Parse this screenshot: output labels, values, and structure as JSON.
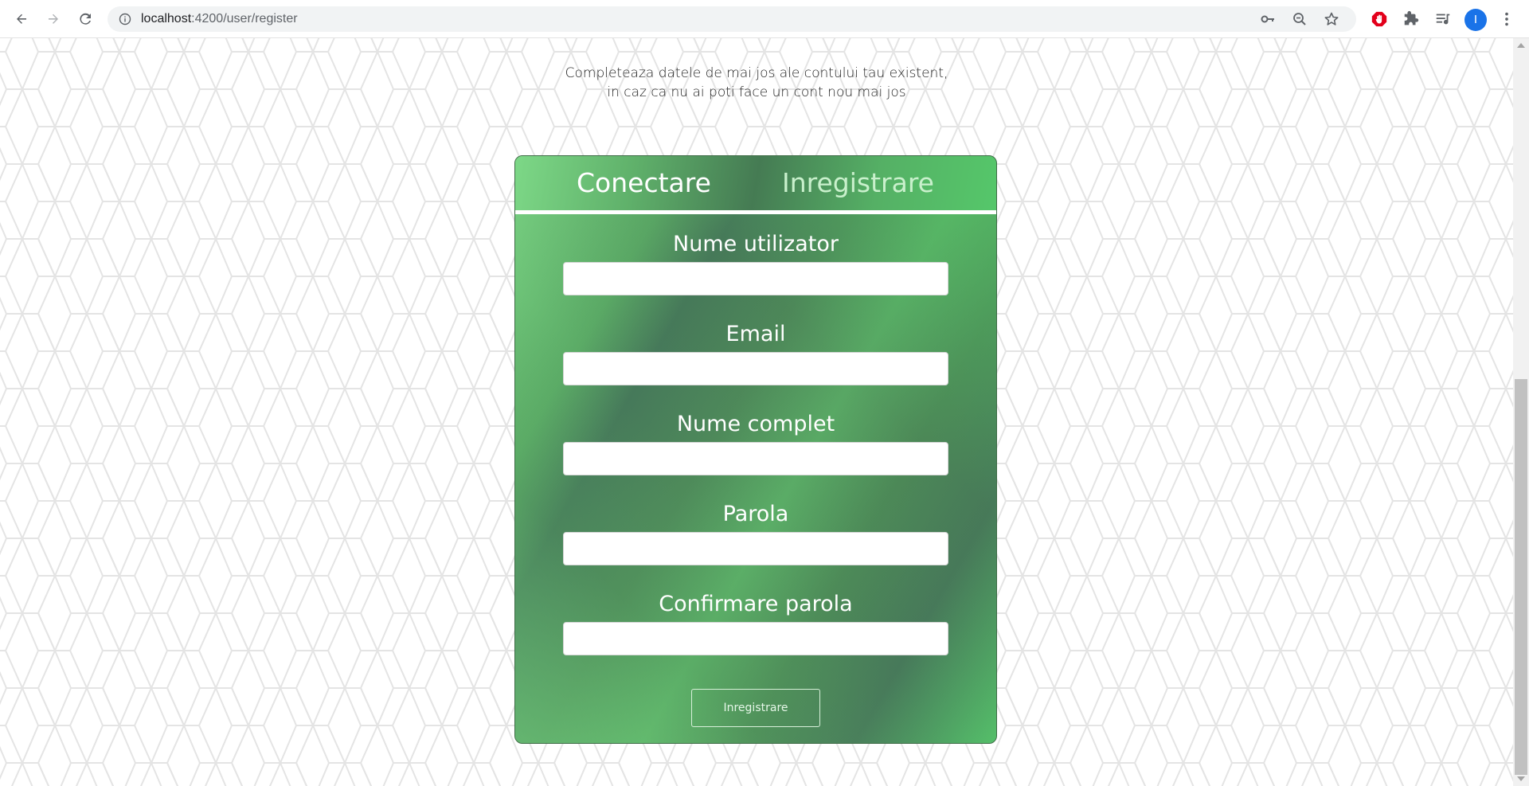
{
  "browser": {
    "url_host": "localhost",
    "url_rest": ":4200/user/register",
    "profile_initial": "I",
    "icons": {
      "back": "back-arrow-icon",
      "forward": "forward-arrow-icon",
      "reload": "reload-icon",
      "site_info": "info-icon",
      "password": "key-icon",
      "zoom": "zoom-out-icon",
      "bookmark": "star-icon",
      "adblock": "stop-hand-icon",
      "extensions": "puzzle-icon",
      "media": "media-queue-icon",
      "menu": "kebab-menu-icon"
    }
  },
  "page": {
    "intro_line1": "Completeaza datele de mai jos ale contului tau existent,",
    "intro_line2": "in caz ca nu ai poti face un cont nou mai jos"
  },
  "auth_card": {
    "tabs": {
      "login": "Conectare",
      "register": "Inregistrare"
    },
    "fields": [
      {
        "label": "Nume utilizator",
        "value": ""
      },
      {
        "label": "Email",
        "value": ""
      },
      {
        "label": "Nume complet",
        "value": ""
      },
      {
        "label": "Parola",
        "value": ""
      },
      {
        "label": "Confirmare parola",
        "value": ""
      }
    ],
    "submit_label": "Inregistrare"
  },
  "colors": {
    "accent_green": "#5ab866",
    "dark_green": "#457b53",
    "profile_blue": "#1a73e8",
    "adblock_red": "#e3001b"
  }
}
